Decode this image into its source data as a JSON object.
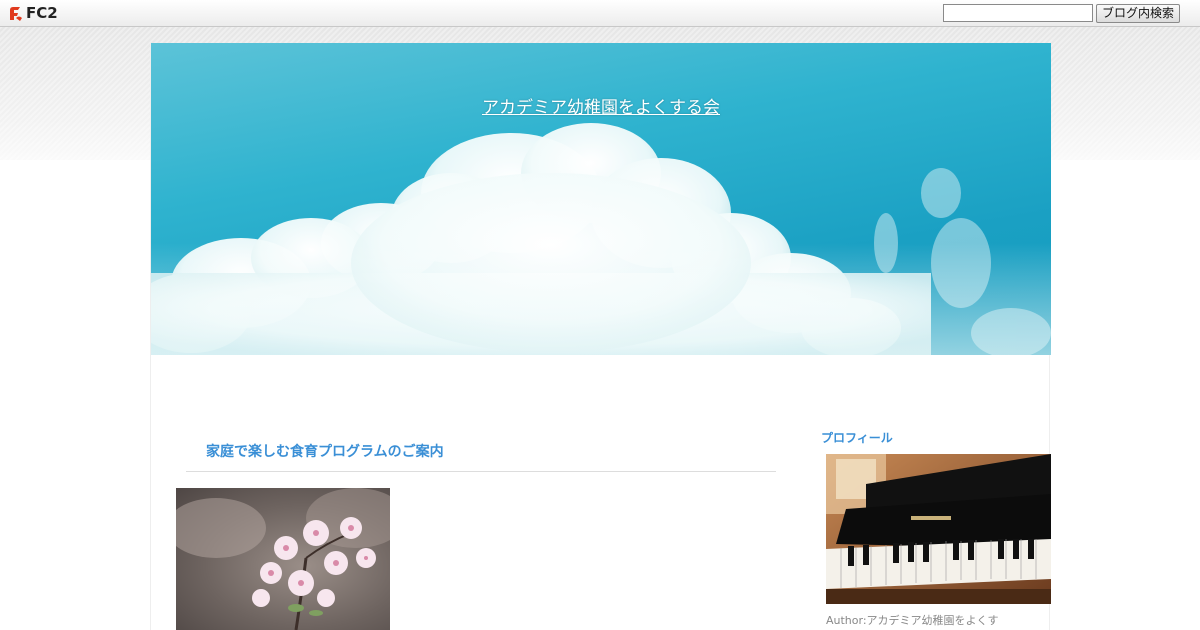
{
  "fc2_bar": {
    "logo_text": "FC2",
    "search": {
      "value": "",
      "placeholder": ""
    },
    "search_button_label": "ブログ内検索"
  },
  "header": {
    "blog_title": "アカデミア幼稚園をよくする会"
  },
  "entry": {
    "title": "家庭で楽しむ食育プログラムのご案内"
  },
  "sidebar": {
    "profile_heading": "プロフィール",
    "author_line": "Author:アカデミア幼稚園をよくす"
  },
  "colors": {
    "link_blue": "#3a8fd6",
    "sky": "#1aa0c3",
    "muted_text": "#888888"
  }
}
